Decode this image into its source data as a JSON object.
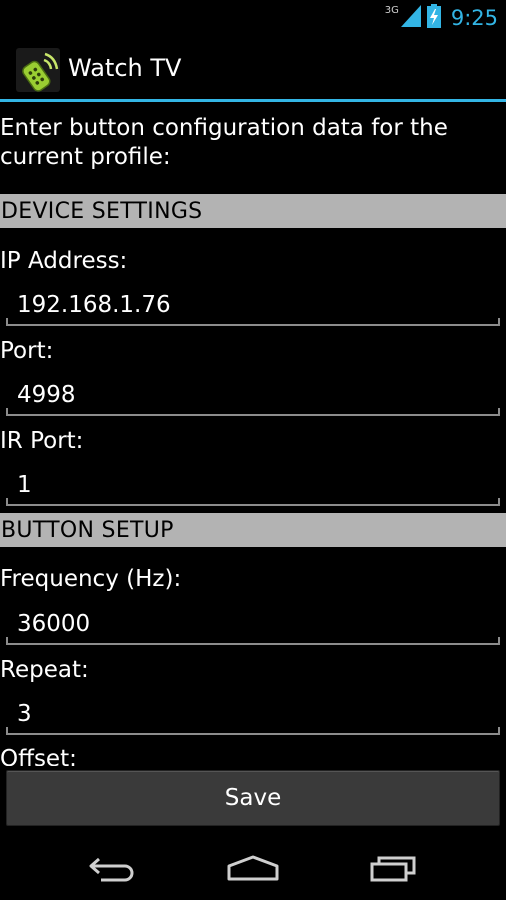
{
  "status_bar": {
    "network": "3G",
    "time": "9:25",
    "accent_color": "#33b5e5"
  },
  "action_bar": {
    "title": "Watch TV",
    "icon": "remote-control-app-icon"
  },
  "intro_text": "Enter button configuration data for the current profile:",
  "sections": {
    "device": {
      "header": "DEVICE SETTINGS",
      "ip_label": "IP Address:",
      "ip_value": "192.168.1.76",
      "port_label": "Port:",
      "port_value": "4998",
      "ir_port_label": "IR Port:",
      "ir_port_value": "1"
    },
    "button": {
      "header": "BUTTON SETUP",
      "frequency_label": "Frequency (Hz):",
      "frequency_value": "36000",
      "repeat_label": "Repeat:",
      "repeat_value": "3",
      "offset_label": "Offset:"
    }
  },
  "save_label": "Save",
  "nav_bar": {
    "back_icon": "back-icon",
    "home_icon": "home-icon",
    "recents_icon": "recent-apps-icon"
  }
}
